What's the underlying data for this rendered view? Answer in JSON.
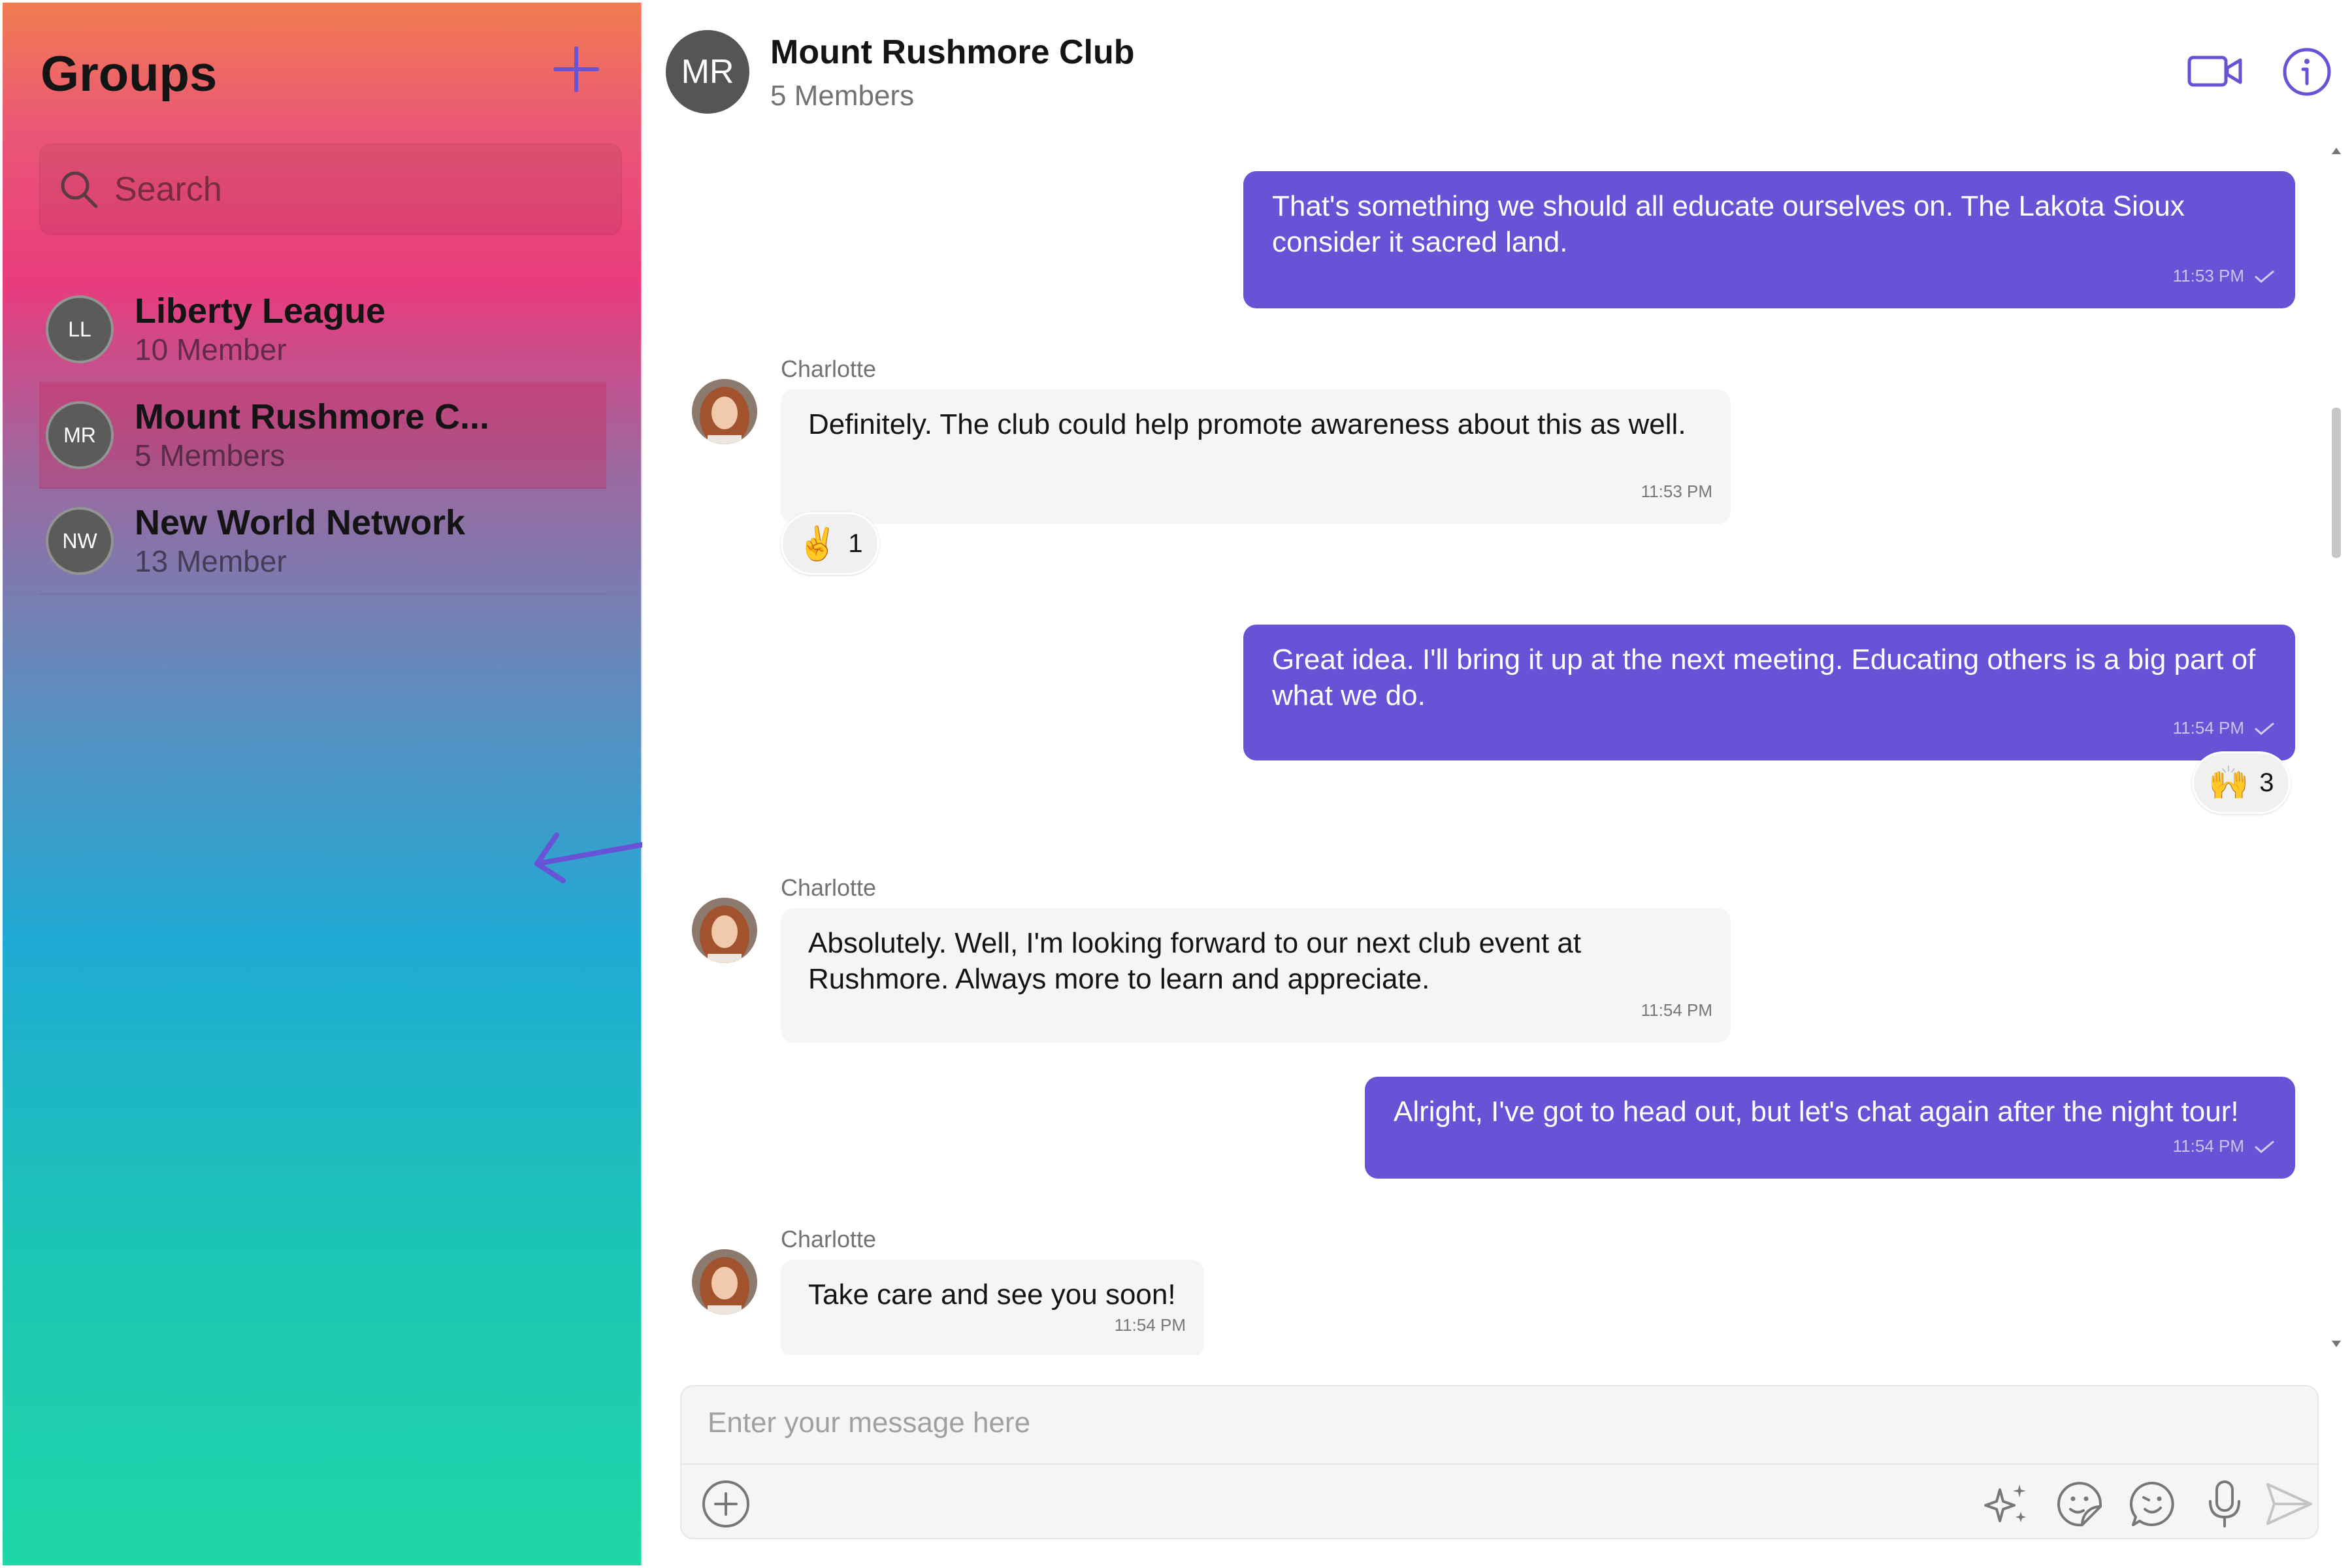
{
  "sidebar": {
    "title": "Groups",
    "search_placeholder": "Search",
    "groups": [
      {
        "initials": "LL",
        "name": "Liberty League",
        "members": "10 Member"
      },
      {
        "initials": "MR",
        "name": "Mount Rushmore C...",
        "members": "5 Members"
      },
      {
        "initials": "NW",
        "name": "New World Network",
        "members": "13 Member"
      }
    ]
  },
  "chat": {
    "header": {
      "initials": "MR",
      "name": "Mount Rushmore Club",
      "members": "5 Members"
    },
    "messages": [
      {
        "direction": "out",
        "text": "That's something we should all educate ourselves on. The Lakota Sioux consider it sacred land.",
        "time": "11:53 PM"
      },
      {
        "direction": "in",
        "sender": "Charlotte",
        "text": "Definitely. The club could help promote awareness about this as well.",
        "time": "11:53 PM",
        "reaction": {
          "emoji": "✌️",
          "count": "1"
        }
      },
      {
        "direction": "out",
        "text": "Great idea. I'll bring it up at the next meeting. Educating others is a big part of what we do.",
        "time": "11:54 PM",
        "reaction": {
          "emoji": "🙌",
          "count": "3"
        }
      },
      {
        "direction": "in",
        "sender": "Charlotte",
        "text": "Absolutely. Well, I'm looking forward to our next club event at Rushmore. Always more to learn and appreciate.",
        "time": "11:54 PM"
      },
      {
        "direction": "out",
        "text": "Alright, I've got to head out, but let's chat again after the night tour!",
        "time": "11:54 PM"
      },
      {
        "direction": "in",
        "sender": "Charlotte",
        "text": "Take care and see you soon!",
        "time": "11:54 PM"
      }
    ],
    "composer": {
      "placeholder": "Enter your message here"
    }
  },
  "colors": {
    "accent": "#6852d6",
    "incoming_bubble": "#f5f5f5"
  },
  "icons": [
    "add-icon",
    "search-icon",
    "video-call-icon",
    "info-icon",
    "read-check-icon",
    "attach-plus-icon",
    "ai-sparkle-icon",
    "sticker-icon",
    "emoji-icon",
    "microphone-icon",
    "send-icon"
  ]
}
